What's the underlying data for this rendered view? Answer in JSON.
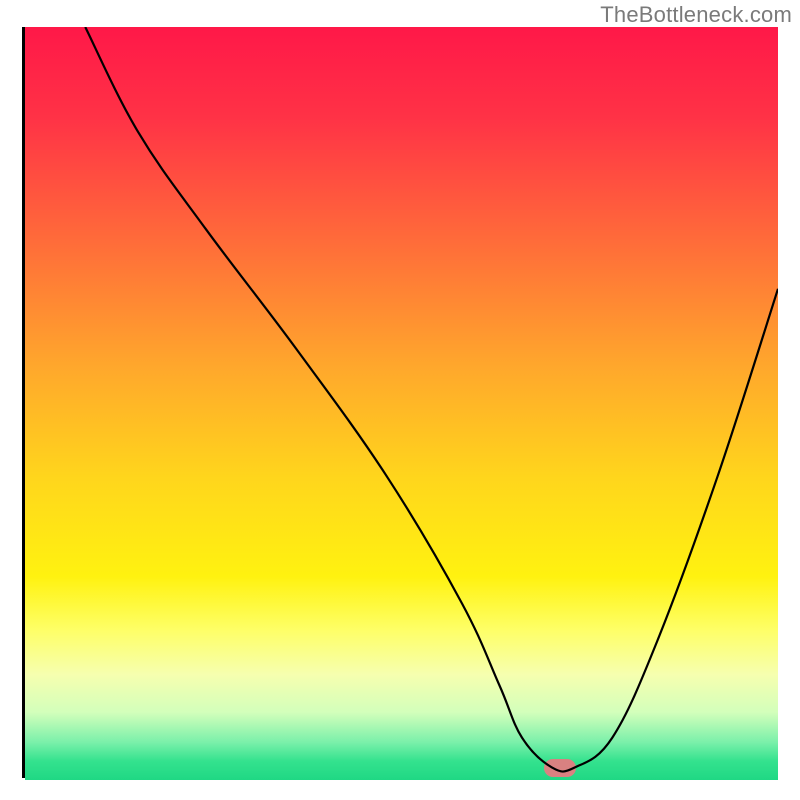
{
  "watermark": "TheBottleneck.com",
  "chart_data": {
    "type": "line",
    "title": "",
    "xlabel": "",
    "ylabel": "",
    "xlim": [
      0,
      100
    ],
    "ylim": [
      0,
      100
    ],
    "grid": false,
    "legend": false,
    "gradient_stops": [
      {
        "offset": 0.0,
        "color": "#ff1848"
      },
      {
        "offset": 0.12,
        "color": "#ff3246"
      },
      {
        "offset": 0.28,
        "color": "#ff6a3a"
      },
      {
        "offset": 0.45,
        "color": "#ffa72c"
      },
      {
        "offset": 0.6,
        "color": "#ffd61c"
      },
      {
        "offset": 0.73,
        "color": "#fff210"
      },
      {
        "offset": 0.8,
        "color": "#feff66"
      },
      {
        "offset": 0.86,
        "color": "#f6ffaf"
      },
      {
        "offset": 0.91,
        "color": "#d3ffbb"
      },
      {
        "offset": 0.95,
        "color": "#7af0aa"
      },
      {
        "offset": 0.975,
        "color": "#34e28e"
      },
      {
        "offset": 1.0,
        "color": "#1fd884"
      }
    ],
    "series": [
      {
        "name": "bottleneck-curve",
        "color": "#000000",
        "x": [
          8,
          15,
          24,
          36,
          48,
          58,
          63,
          66,
          70,
          73,
          78,
          84,
          92,
          100
        ],
        "y": [
          100,
          86,
          73,
          57,
          40,
          23,
          12,
          5,
          1,
          1,
          5,
          18,
          40,
          65
        ]
      }
    ],
    "marker": {
      "name": "min-point",
      "x": 71,
      "y": 1,
      "color": "#d98181"
    }
  }
}
